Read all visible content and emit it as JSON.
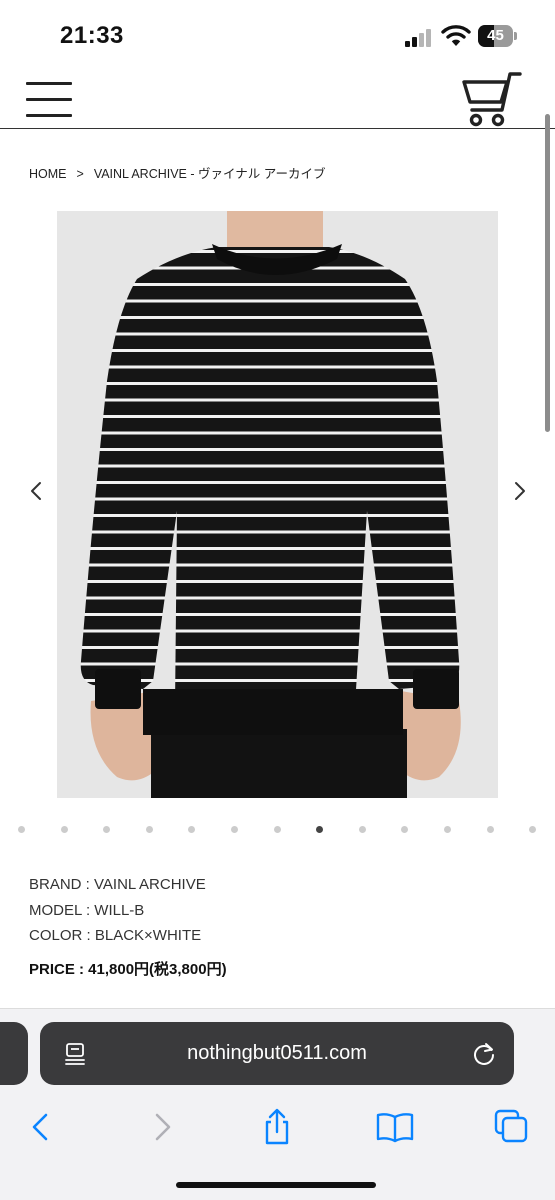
{
  "status_bar": {
    "time": "21:33",
    "battery_level": "45",
    "signal_icon": "cellular-signal-icon",
    "wifi_icon": "wifi-icon"
  },
  "header": {
    "menu_icon": "hamburger-menu-icon",
    "cart_icon": "shopping-cart-icon"
  },
  "breadcrumb": {
    "home": "HOME",
    "separator": ">",
    "current": "VAINL ARCHIVE - ヴァイナル アーカイブ"
  },
  "gallery": {
    "prev_icon": "chevron-left-icon",
    "next_icon": "chevron-right-icon",
    "dots": [
      {
        "active": false
      },
      {
        "active": false
      },
      {
        "active": false
      },
      {
        "active": false
      },
      {
        "active": false
      },
      {
        "active": false
      },
      {
        "active": false
      },
      {
        "active": true
      },
      {
        "active": false
      },
      {
        "active": false
      },
      {
        "active": false
      },
      {
        "active": false
      },
      {
        "active": false
      }
    ]
  },
  "product": {
    "brand": "BRAND : VAINL ARCHIVE",
    "model": "MODEL : WILL-B",
    "color": "COLOR : BLACK×WHITE",
    "price": "PRICE : 41,800円(税3,800円)"
  },
  "browser": {
    "url": "nothingbut0511.com",
    "reader_icon": "reader-mode-icon",
    "reload_icon": "reload-icon",
    "toolbar": [
      "back-icon",
      "forward-icon",
      "share-icon",
      "bookmarks-icon",
      "tabs-icon"
    ]
  },
  "colors": {
    "url_bar": "#3a3a3c",
    "toolbar_bg": "#f2f2f4",
    "accent_blue": "#0a84ff",
    "dot_inactive": "#cccccc",
    "dot_active": "#444444"
  }
}
